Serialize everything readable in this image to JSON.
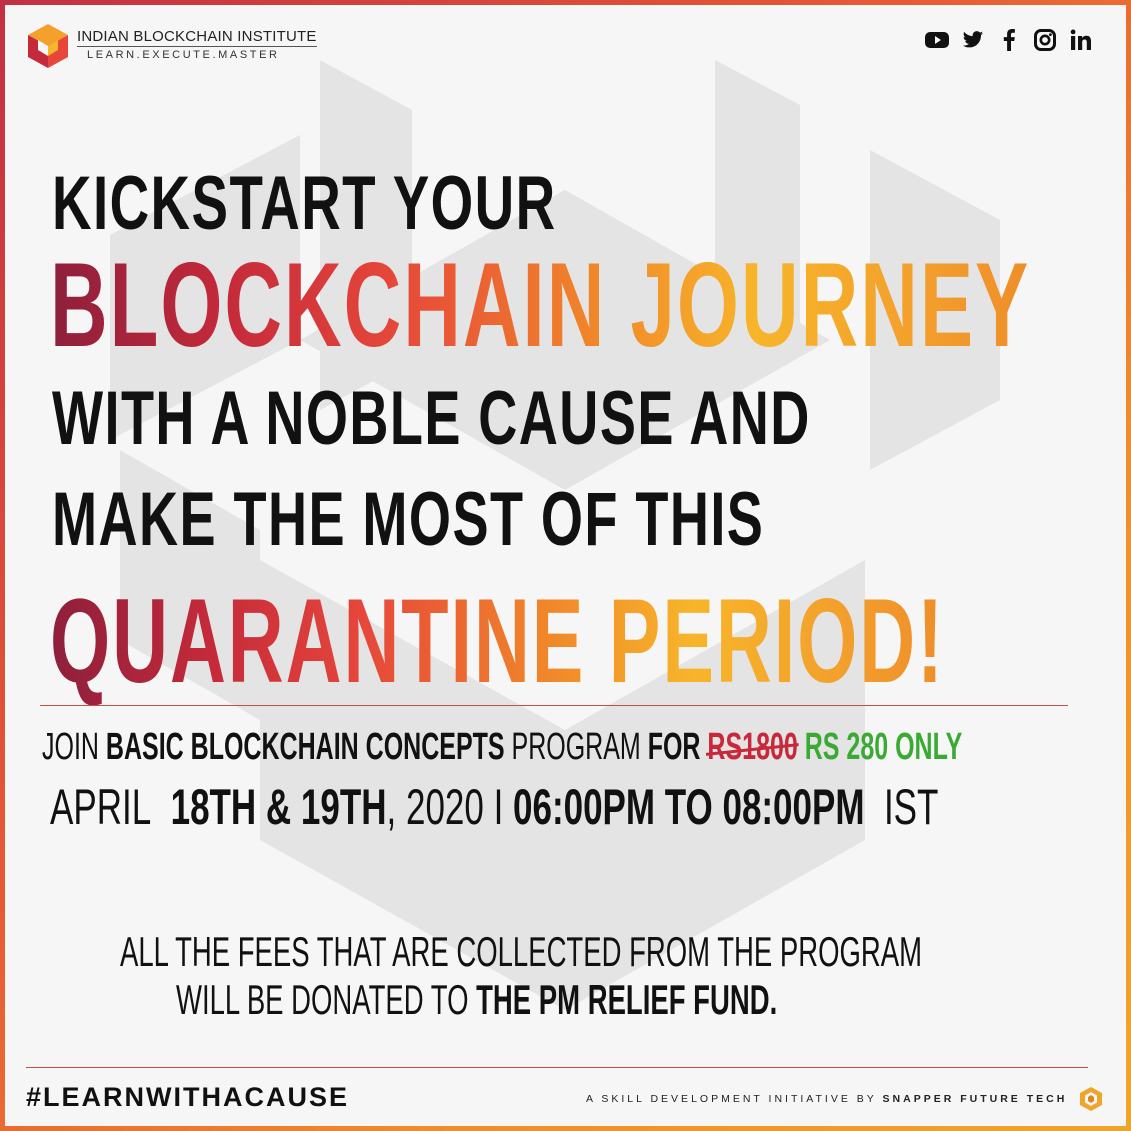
{
  "colors": {
    "accent_dark": "#8e1f3c",
    "accent_red": "#e6473a",
    "accent_orange": "#f0852a",
    "accent_yellow": "#f7b52a",
    "price_green": "#3aaa35",
    "strike_red": "#c8283a",
    "text": "#111111",
    "background": "#f6f6f6"
  },
  "header": {
    "org_name": "INDIAN BLOCKCHAIN INSTITUTE",
    "tagline": "LEARN.EXECUTE.MASTER",
    "logo_icon": "cube-logo-icon",
    "social_icons": [
      "youtube-icon",
      "twitter-icon",
      "facebook-icon",
      "instagram-icon",
      "linkedin-icon"
    ]
  },
  "headline": {
    "line1": "KICKSTART YOUR",
    "line2": "BLOCKCHAIN JOURNEY",
    "line3": "WITH A NOBLE CAUSE AND",
    "line4": "MAKE THE MOST OF THIS",
    "line5": "QUARANTINE PERIOD!"
  },
  "program": {
    "join": "JOIN",
    "name": "BASIC BLOCKCHAIN CONCEPTS",
    "program_word": "PROGRAM",
    "for_word": "FOR",
    "old_price": "RS1800",
    "new_price": "RS 280 ONLY"
  },
  "schedule": {
    "month": "APRIL",
    "days": "18TH & 19TH",
    "year": ", 2020",
    "separator": "I",
    "time": "06:00PM TO 08:00PM",
    "zone": "IST"
  },
  "donation": {
    "line1": "ALL THE  FEES THAT ARE COLLECTED FROM THE PROGRAM",
    "line2_prefix": "WILL BE DONATED TO",
    "line2_bold": "THE PM RELIEF FUND."
  },
  "footer": {
    "hashtag": "#LEARNWITHACAUSE",
    "initiative": "A SKILL DEVELOPMENT INITIATIVE BY",
    "company": "SNAPPER FUTURE TECH",
    "company_icon": "snapper-logo-icon"
  }
}
